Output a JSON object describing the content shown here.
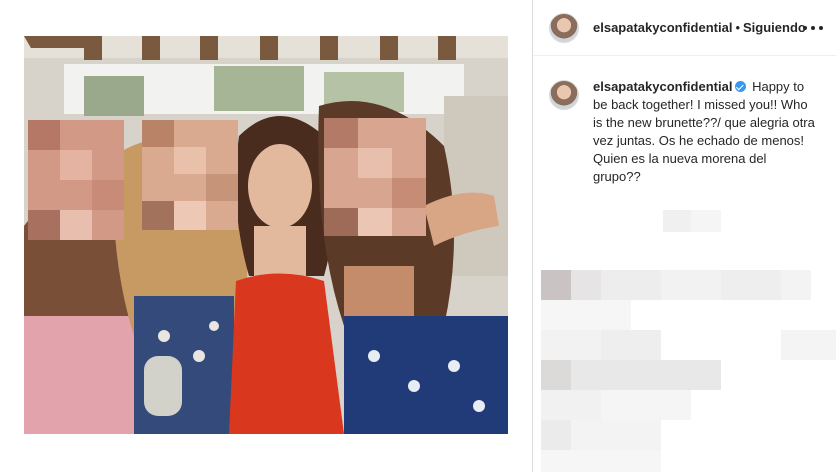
{
  "post": {
    "username": "elsapatakyconfidential",
    "follow_separator": "•",
    "follow_status": "Siguiendo",
    "caption": "Happy to be back together! I missed you!! Who is the new brunette??/ que alegria otra vez juntas. Os he echado de menos! Quien es la nueva morena del grupo??"
  },
  "icons": {
    "more": "more-horizontal-icon",
    "verified": "verified-badge-icon",
    "avatar": "profile-avatar"
  },
  "colors": {
    "verified_blue": "#3897f0",
    "text": "#262626",
    "border": "#dbdbdb"
  }
}
